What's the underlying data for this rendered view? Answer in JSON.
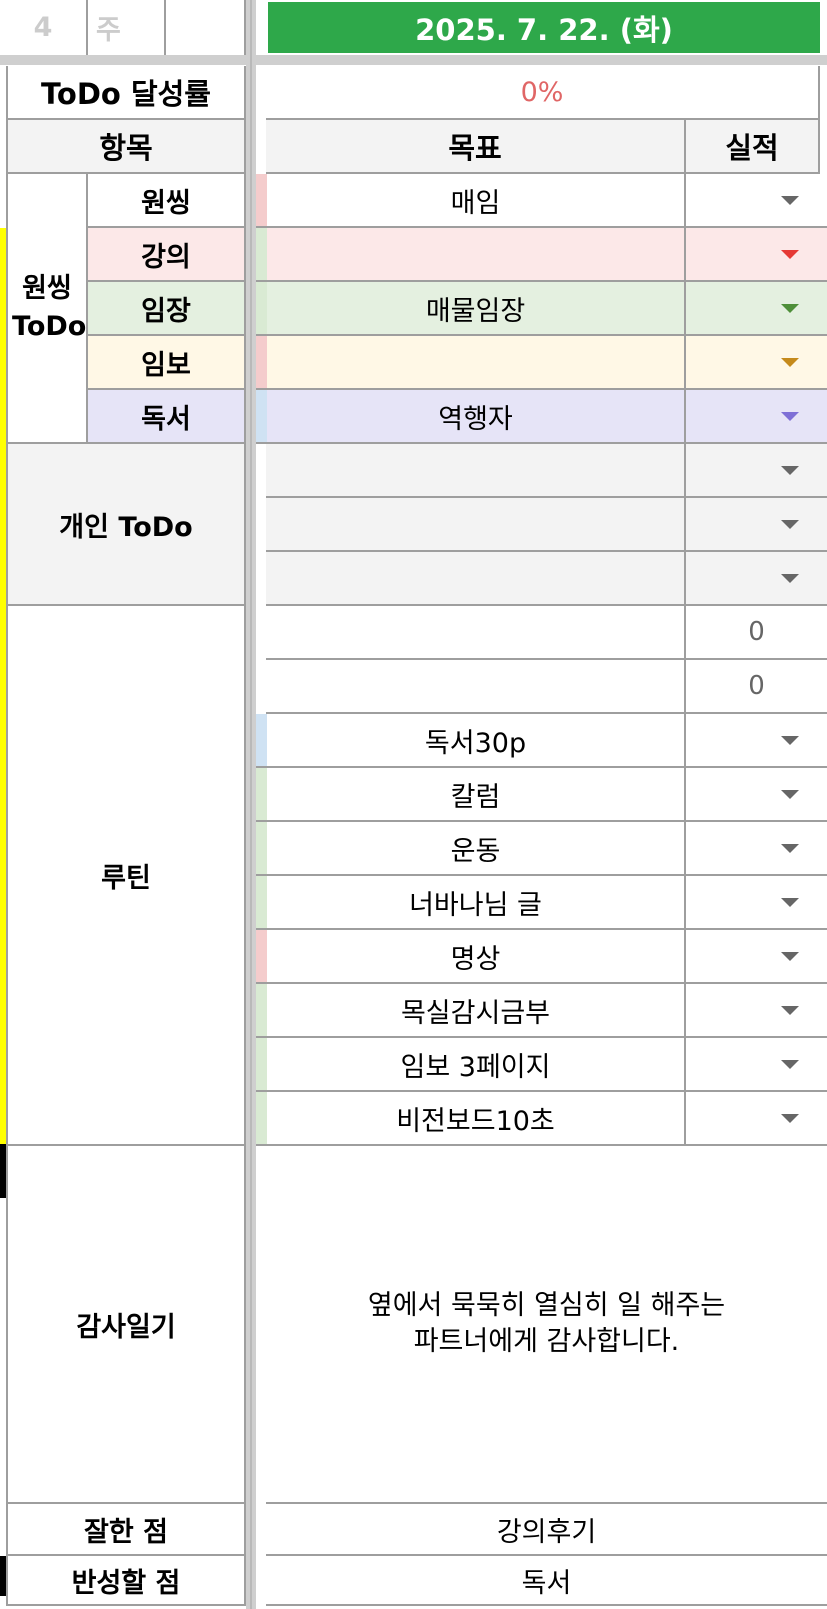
{
  "top": {
    "week_num": "4",
    "week_label": "주",
    "date": "2025. 7. 22. (화)",
    "date_bg": "#2ea84a"
  },
  "todo_rate": {
    "label": "ToDo 달성률",
    "value": "0%",
    "value_color": "#e06666"
  },
  "headers": {
    "item": "항목",
    "goal": "목표",
    "result": "실적"
  },
  "wonssing": {
    "group_label": "원씽 ToDo",
    "rows": [
      {
        "label": "원씽",
        "goal": "매임",
        "bg": "#ffffff",
        "label_bg": "#ffffff",
        "marker": "#f4cccc",
        "arrow": "#666666"
      },
      {
        "label": "강의",
        "goal": "",
        "bg": "#fce8e8",
        "label_bg": "#fce8e8",
        "marker": "#d9ead3",
        "arrow": "#e53935"
      },
      {
        "label": "임장",
        "goal": "매물임장",
        "bg": "#e4f0e0",
        "label_bg": "#e4f0e0",
        "marker": "#d9ead3",
        "arrow": "#4e8f3a"
      },
      {
        "label": "임보",
        "goal": "",
        "bg": "#fff8e6",
        "label_bg": "#fff8e6",
        "marker": "#f4cccc",
        "arrow": "#c58a1b"
      },
      {
        "label": "독서",
        "goal": "역행자",
        "bg": "#e6e4f7",
        "label_bg": "#e6e4f7",
        "marker": "#cfe2f3",
        "arrow": "#7e6fd6"
      }
    ]
  },
  "personal": {
    "label": "개인 ToDo",
    "rows": [
      {
        "goal": ""
      },
      {
        "goal": ""
      },
      {
        "goal": ""
      }
    ]
  },
  "routine": {
    "label": "루틴",
    "rows": [
      {
        "goal": "",
        "result": "0",
        "marker": "#ffffff"
      },
      {
        "goal": "",
        "result": "0",
        "marker": "#ffffff"
      },
      {
        "goal": "독서30p",
        "result": "",
        "marker": "#cfe2f3"
      },
      {
        "goal": "칼럼",
        "result": "",
        "marker": "#d9ead3"
      },
      {
        "goal": "운동",
        "result": "",
        "marker": "#d9ead3"
      },
      {
        "goal": "너바나님 글",
        "result": "",
        "marker": "#d9ead3"
      },
      {
        "goal": "명상",
        "result": "",
        "marker": "#f4cccc"
      },
      {
        "goal": "목실감시금부",
        "result": "",
        "marker": "#d9ead3"
      },
      {
        "goal": "임보 3페이지",
        "result": "",
        "marker": "#d9ead3"
      },
      {
        "goal": "비전보드10초",
        "result": "",
        "marker": "#d9ead3"
      }
    ]
  },
  "gratitude": {
    "label": "감사일기",
    "line1": "옆에서 묵묵히 열심히 일 해주는",
    "line2": "파트너에게 감사합니다."
  },
  "good_point": {
    "label": "잘한 점",
    "value": "강의후기"
  },
  "reflect_point": {
    "label": "반성할 점",
    "value": "독서"
  }
}
